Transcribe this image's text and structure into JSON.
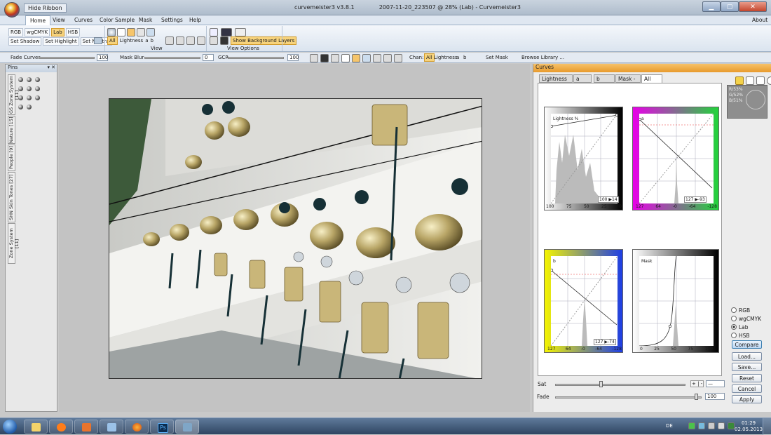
{
  "titlebar": {
    "hide_ribbon": "Hide Ribbon",
    "app_name": "curvemeister3 v3.8.1",
    "document": "2007-11-20_223507 @ 28% (Lab) - Curvemeister3"
  },
  "tabs": [
    "Home",
    "View",
    "Curves",
    "Color Sample",
    "Mask",
    "Settings",
    "Help"
  ],
  "about": "About",
  "ribbon": {
    "modes": [
      "RGB",
      "wgCMYK",
      "Lab",
      "HSB"
    ],
    "set_shadow": "Set Shadow",
    "set_highlight": "Set Highlight",
    "set_neutral": "Set Neutral",
    "all": "All",
    "lightness": "Lightness",
    "a": "a",
    "b": "b",
    "group_view": "View",
    "show_background_layers": "Show Background Layers",
    "group_view_options": "View Options"
  },
  "toolbar": {
    "fade_curves": "Fade Curves",
    "fade_value": "100",
    "mask_blur": "Mask Blur",
    "mask_blur_value": "0",
    "gcr": "GCR",
    "gcr_value": "100",
    "chan": "Chan:",
    "chan_all": "All",
    "chan_lightness": "Lightness",
    "chan_a": "a",
    "chan_b": "b",
    "set_mask": "Set Mask",
    "browse_library": "Browse Library ..."
  },
  "pins": {
    "title": "Pins",
    "tabs": [
      "GS Zone System [11]",
      "Nature [15]",
      "People [9]",
      "SHN Skin Tones [27]",
      "Zone System [11]"
    ]
  },
  "curves": {
    "title": "Curves",
    "tabs": [
      "Lightness",
      "a",
      "b",
      "Mask - a",
      "All"
    ],
    "readout": [
      "R/53%",
      "G/52%",
      "B/51%"
    ],
    "graphs": [
      {
        "label": "Lightness %",
        "readout": "100 ▶14",
        "axis": [
          "100",
          "75",
          "50",
          "25",
          "0"
        ]
      },
      {
        "label": "a",
        "readout": "127 ▶-93",
        "axis": [
          "127",
          "64",
          "-0",
          "-64",
          "-128"
        ]
      },
      {
        "label": "b",
        "readout": "127 ▶-74",
        "axis": [
          "127",
          "64",
          "-0",
          "-64",
          "-128"
        ]
      },
      {
        "label": "Mask",
        "readout": "",
        "axis": [
          "0",
          "25",
          "50",
          "75",
          "100"
        ]
      }
    ],
    "color_modes": [
      "RGB",
      "wgCMYK",
      "Lab",
      "HSB"
    ],
    "selected_mode": "Lab",
    "buttons": [
      "Compare",
      "Load...",
      "Save...",
      "Reset",
      "Cancel",
      "Apply"
    ],
    "sat_label": "Sat",
    "sat_value": "—",
    "fade_label": "Fade",
    "fade_value": "100"
  },
  "taskbar": {
    "lang": "DE",
    "time": "01:29",
    "date": "02.05.2013",
    "ps_label": "Ps"
  }
}
